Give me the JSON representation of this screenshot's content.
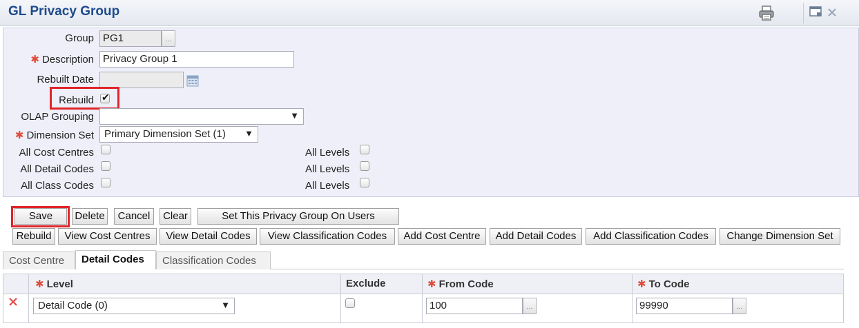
{
  "header": {
    "title": "GL Privacy Group"
  },
  "form": {
    "group_label": "Group",
    "group_value": "PG1",
    "description_label": "Description",
    "description_value": "Privacy Group 1",
    "rebuilt_date_label": "Rebuilt Date",
    "rebuilt_date_value": "",
    "rebuild_label": "Rebuild",
    "rebuild_checked": true,
    "olap_label": "OLAP Grouping",
    "olap_value": "",
    "dimension_set_label": "Dimension Set",
    "dimension_set_value": "Primary Dimension Set (1)",
    "all_cost_centres_label": "All Cost Centres",
    "all_detail_codes_label": "All Detail Codes",
    "all_class_codes_label": "All Class Codes",
    "all_levels_label": "All Levels"
  },
  "buttons": {
    "row1": [
      "Save",
      "Delete",
      "Cancel",
      "Clear",
      "Set This Privacy Group On Users"
    ],
    "row2": [
      "Rebuild",
      "View Cost Centres",
      "View Detail Codes",
      "View Classification Codes",
      "Add Cost Centre",
      "Add Detail Codes",
      "Add Classification Codes",
      "Change Dimension Set"
    ]
  },
  "tabs": [
    "Cost Centre",
    "Detail Codes",
    "Classification Codes"
  ],
  "active_tab": "Detail Codes",
  "grid": {
    "columns": [
      "Level",
      "Exclude",
      "From Code",
      "To Code"
    ],
    "rows": [
      {
        "level": "Detail Code (0)",
        "exclude": false,
        "from_code": "100",
        "to_code": "99990"
      }
    ]
  },
  "colors": {
    "title": "#1d4a8c",
    "required": "#e04b3a",
    "highlight": "#e0242a",
    "panel": "#eeeff8"
  },
  "icons": [
    "print-icon",
    "window-icon",
    "close-icon",
    "calendar-icon",
    "ellipsis-icon",
    "delete-row-icon"
  ]
}
